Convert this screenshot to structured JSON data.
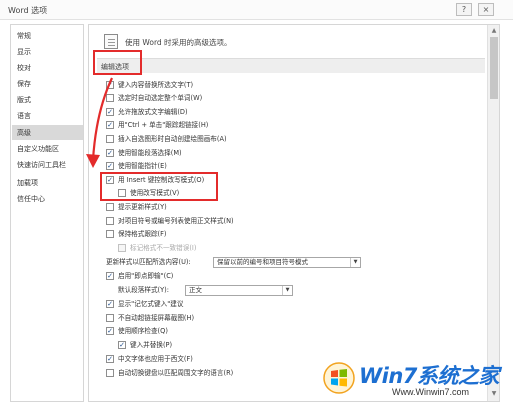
{
  "window": {
    "title": "Word 选项",
    "help_glyph": "?",
    "close_glyph": "×"
  },
  "sidebar": {
    "items": [
      {
        "label": "常规"
      },
      {
        "label": "显示"
      },
      {
        "label": "校对"
      },
      {
        "label": "保存"
      },
      {
        "label": "版式"
      },
      {
        "label": "语言"
      },
      {
        "label": "高级",
        "selected": true
      },
      {
        "label": "自定义功能区"
      },
      {
        "label": "快速访问工具栏"
      },
      {
        "label": "加载项"
      },
      {
        "label": "信任中心"
      }
    ]
  },
  "main": {
    "header": "使用 Word 时采用的高级选项。",
    "section_title": "编辑选项",
    "options": [
      {
        "label": "键入内容替换所选文字(T)",
        "checked": true
      },
      {
        "label": "选定时自动选定整个单词(W)",
        "checked": false
      },
      {
        "label": "允许拖放式文字编辑(D)",
        "checked": true
      },
      {
        "label": "用\"Ctrl + 单击\"跟踪超链接(H)",
        "checked": true
      },
      {
        "label": "插入自选图形时自动创建绘图画布(A)",
        "checked": false
      },
      {
        "label": "使用智能段落选择(M)",
        "checked": true
      },
      {
        "label": "使用智能指针(E)",
        "checked": true
      },
      {
        "label": "用 Insert 键控制改写模式(O)",
        "checked": true
      },
      {
        "label": "使用改写模式(V)",
        "checked": false
      },
      {
        "label": "提示更新样式(Y)",
        "checked": false
      },
      {
        "label": "对项目符号或编号列表使用正文样式(N)",
        "checked": false
      },
      {
        "label": "保持格式跟踪(F)",
        "checked": false
      },
      {
        "label": "标记格式不一致错误(I)",
        "checked": false,
        "disabled": true
      }
    ],
    "paste_label": "更新样式以匹配所选内容(U):",
    "paste_value": "保留以前的编号和项目符号模式",
    "click_and_type": {
      "label": "启用\"即点即输\"(C)",
      "checked": true
    },
    "default_style_label": "默认段落样式(Y):",
    "default_style_value": "正文",
    "options2": [
      {
        "label": "显示\"记忆式键入\"建议",
        "checked": true
      },
      {
        "label": "不自动超链接屏幕截图(H)",
        "checked": false
      },
      {
        "label": "使用顺序检查(Q)",
        "checked": true
      },
      {
        "label": "键入并替换(P)",
        "checked": true
      },
      {
        "label": "中文字体也应用于西文(F)",
        "checked": true
      },
      {
        "label": "自动切换键盘以匹配周围文字的语言(R)",
        "checked": false
      }
    ]
  },
  "watermark": {
    "title": "Win7系统之家",
    "url": "Www.Winwin7.com"
  },
  "colors": {
    "highlight_red": "#e32b2b",
    "selected_nav": "#d9d9d9",
    "brand_blue": "#1d6fd1"
  }
}
